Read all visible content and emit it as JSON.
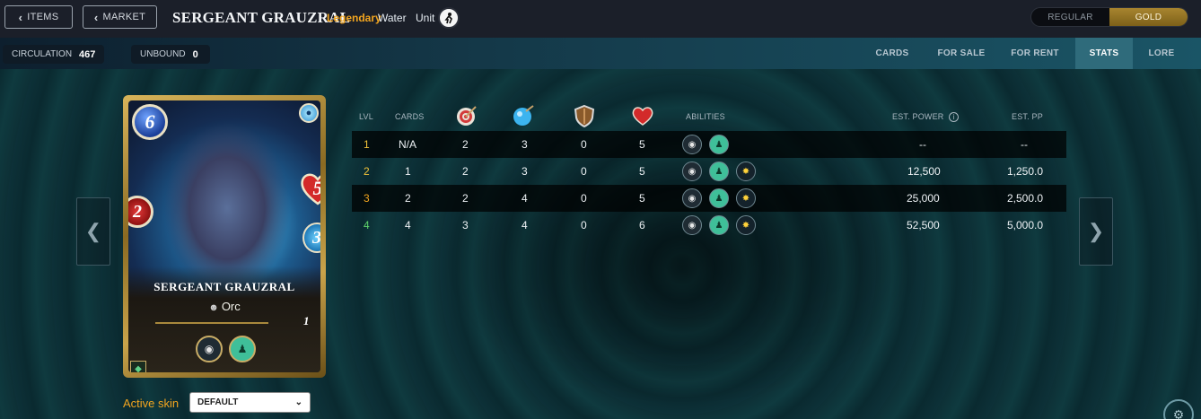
{
  "header": {
    "items_label": "ITEMS",
    "market_label": "MARKET",
    "title": "SERGEANT GRAUZRAL",
    "rarity": "Legendary",
    "element": "Water",
    "unit_label": "Unit",
    "toggle": {
      "regular": "REGULAR",
      "gold": "GOLD",
      "selected": "GOLD"
    }
  },
  "subbar": {
    "circulation_label": "CIRCULATION",
    "circulation_value": "467",
    "unbound_label": "UNBOUND",
    "unbound_value": "0",
    "tabs": [
      {
        "label": "CARDS"
      },
      {
        "label": "FOR SALE"
      },
      {
        "label": "FOR RENT"
      },
      {
        "label": "STATS"
      },
      {
        "label": "LORE"
      }
    ],
    "active_tab": "STATS"
  },
  "card": {
    "mana": "6",
    "health": "5",
    "attack": "2",
    "speed": "3",
    "name": "SERGEANT GRAUZRAL",
    "type": "Orc",
    "level": "1",
    "abilities": [
      "eye-icon",
      "person-icon"
    ]
  },
  "skin": {
    "label": "Active skin",
    "selected": "DEFAULT"
  },
  "stats_table": {
    "headers": {
      "lvl": "LVL",
      "cards": "CARDS",
      "abilities": "ABILITIES",
      "est_power": "EST. POWER",
      "est_pp": "EST. PP"
    },
    "header_icons": [
      "ranged-target-icon",
      "magic-orb-icon",
      "armor-shield-icon",
      "health-heart-icon"
    ],
    "rows": [
      {
        "lvl": "1",
        "cards": "N/A",
        "ranged": "2",
        "magic": "3",
        "armor": "0",
        "health": "5",
        "est_power": "--",
        "est_pp": "--"
      },
      {
        "lvl": "2",
        "cards": "1",
        "ranged": "2",
        "magic": "3",
        "armor": "0",
        "health": "5",
        "est_power": "12,500",
        "est_pp": "1,250.0"
      },
      {
        "lvl": "3",
        "cards": "2",
        "ranged": "2",
        "magic": "4",
        "armor": "0",
        "health": "5",
        "est_power": "25,000",
        "est_pp": "2,500.0"
      },
      {
        "lvl": "4",
        "cards": "4",
        "ranged": "3",
        "magic": "4",
        "armor": "0",
        "health": "6",
        "est_power": "52,500",
        "est_pp": "5,000.0"
      }
    ],
    "lvl_colors": [
      "#f0c23a",
      "#f0c23a",
      "#f2a51f",
      "#5fd36a"
    ]
  }
}
